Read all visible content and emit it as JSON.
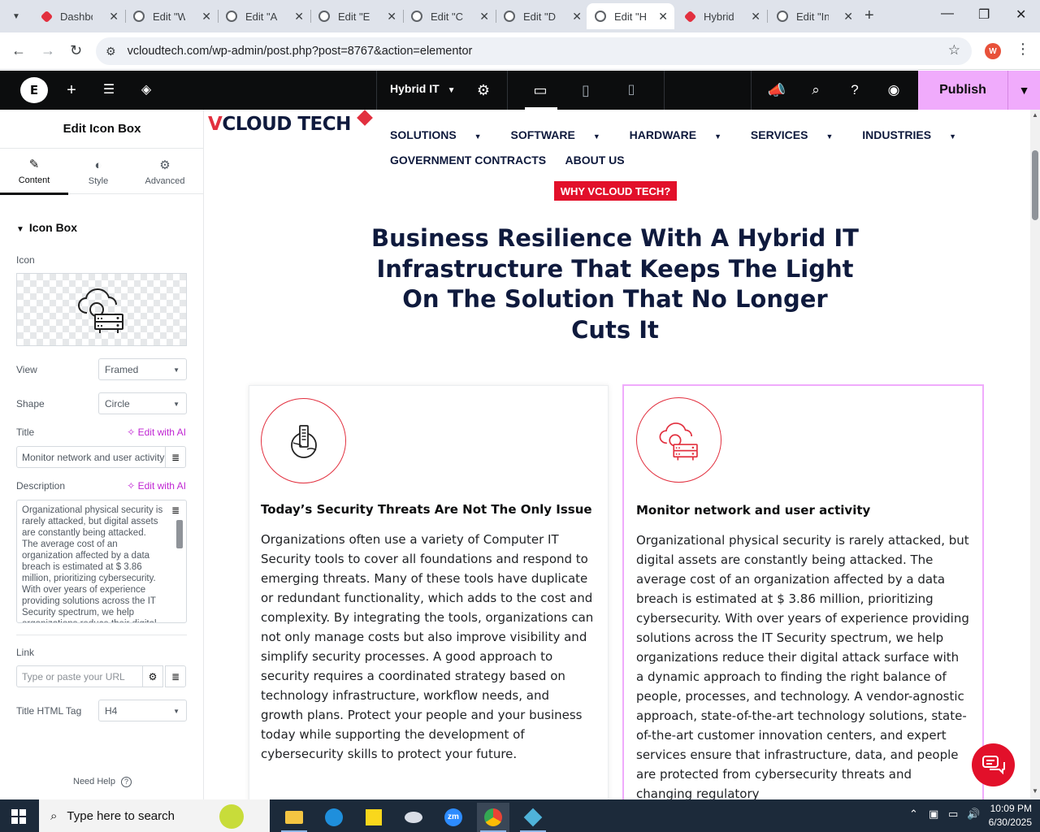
{
  "browser": {
    "tabs": [
      {
        "label": "Dashboard",
        "favicon": "red-diamond"
      },
      {
        "label": "Edit \"Wo",
        "favicon": "wordpress"
      },
      {
        "label": "Edit \"Ap",
        "favicon": "wordpress"
      },
      {
        "label": "Edit \"Ele",
        "favicon": "wordpress"
      },
      {
        "label": "Edit \"Cy",
        "favicon": "wordpress"
      },
      {
        "label": "Edit \"De",
        "favicon": "wordpress"
      },
      {
        "label": "Edit \"Hy",
        "favicon": "wordpress",
        "active": true
      },
      {
        "label": "Hybrid I",
        "favicon": "red-diamond"
      },
      {
        "label": "Edit \"Inc",
        "favicon": "wordpress"
      }
    ],
    "url": "vcloudtech.com/wp-admin/post.php?post=8767&action=elementor",
    "profile_initial": "W"
  },
  "elementor": {
    "page_name": "Hybrid IT",
    "publish_label": "Publish",
    "panel": {
      "title": "Edit Icon Box",
      "tabs": [
        "Content",
        "Style",
        "Advanced"
      ],
      "section": "Icon Box",
      "icon_label": "Icon",
      "view_label": "View",
      "view_value": "Framed",
      "shape_label": "Shape",
      "shape_value": "Circle",
      "title_label": "Title",
      "ai_label": "Edit with AI",
      "title_value": "Monitor network and user activity",
      "description_label": "Description",
      "description_value": "Organizational physical security is rarely attacked, but digital assets are constantly being attacked. The average cost of an organization affected by a data breach is estimated at $ 3.86 million, prioritizing cybersecurity. With over years of experience providing solutions across the IT Security spectrum, we help organizations reduce their digital",
      "link_label": "Link",
      "link_placeholder": "Type or paste your URL",
      "html_tag_label": "Title HTML Tag",
      "html_tag_value": "H4",
      "need_help": "Need Help"
    }
  },
  "site": {
    "logo": {
      "prefix": "V",
      "rest": "CLOUD TECH"
    },
    "menu_row1": [
      "SOLUTIONS",
      "SOFTWARE",
      "HARDWARE",
      "SERVICES",
      "INDUSTRIES"
    ],
    "menu_row2": [
      "GOVERNMENT CONTRACTS",
      "ABOUT US"
    ],
    "cta": "WHY VCLOUD TECH?",
    "hero": "Business Resilience With A Hybrid IT Infrastructure That Keeps The Light On The Solution That No Longer Cuts It",
    "cards": [
      {
        "title": "Today’s Security Threats Are Not The Only Issue",
        "description": "Organizations often use a variety of Computer IT Security tools to cover all foundations and respond to emerging threats. Many of these tools have duplicate or redundant functionality, which adds to the cost and complexity. By integrating the tools, organizations can not only manage costs but also improve visibility and simplify security processes. A good approach to security requires a coordinated strategy based on technology infrastructure, workflow needs, and growth plans. Protect your people and your business today while supporting the development of cybersecurity skills to protect your future."
      },
      {
        "title": "Monitor network and user activity",
        "description": "Organizational physical security is rarely attacked, but digital assets are constantly being attacked. The average cost of an organization affected by a data breach is estimated at $ 3.86 million, prioritizing cybersecurity. With over years of experience providing solutions across the IT Security spectrum, we help organizations reduce their digital attack surface with a dynamic approach to finding the right balance of people, processes, and technology. A vendor-agnostic approach, state-of-the-art technology solutions, state-of-the-art customer innovation centers, and expert services ensure that infrastructure, data, and people are protected from cybersecurity threats and changing regulatory"
      }
    ]
  },
  "taskbar": {
    "search_placeholder": "Type here to search",
    "time": "10:09 PM",
    "date": "6/30/2025"
  },
  "colors": {
    "brand_red": "#e2303f",
    "navy": "#0f1a3d",
    "publish_pink": "#f0abfc",
    "ai_purple": "#c026d3"
  }
}
